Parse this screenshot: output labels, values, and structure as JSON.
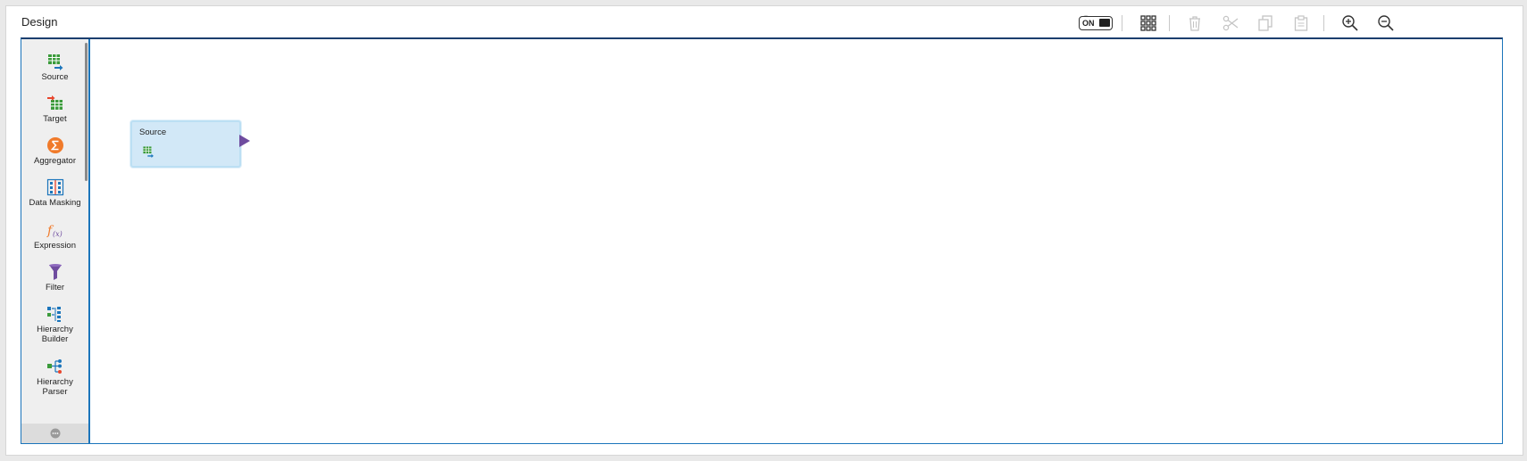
{
  "header": {
    "title": "Design"
  },
  "toolbar": {
    "toggle_label": "ON",
    "icons": [
      "lightbulb-icon",
      "toggle",
      "grid-icon",
      "trash-icon",
      "scissors-icon",
      "copy-icon",
      "paste-icon",
      "zoom-in-icon",
      "zoom-out-icon"
    ]
  },
  "palette": {
    "items": [
      {
        "label": "Source",
        "icon": "source-icon"
      },
      {
        "label": "Target",
        "icon": "target-icon"
      },
      {
        "label": "Aggregator",
        "icon": "aggregator-icon"
      },
      {
        "label": "Data Masking",
        "icon": "data-masking-icon"
      },
      {
        "label": "Expression",
        "icon": "expression-icon"
      },
      {
        "label": "Filter",
        "icon": "filter-icon"
      },
      {
        "label": "Hierarchy\nBuilder",
        "icon": "hierarchy-builder-icon"
      },
      {
        "label": "Hierarchy\nParser",
        "icon": "hierarchy-parser-icon"
      }
    ],
    "footer_icon": "more-icon"
  },
  "canvas": {
    "nodes": [
      {
        "title": "Source",
        "icon": "source-icon"
      }
    ]
  },
  "colors": {
    "accent": "#1b75bb",
    "node_fill": "#d2e8f7",
    "port": "#6f4c9f"
  }
}
